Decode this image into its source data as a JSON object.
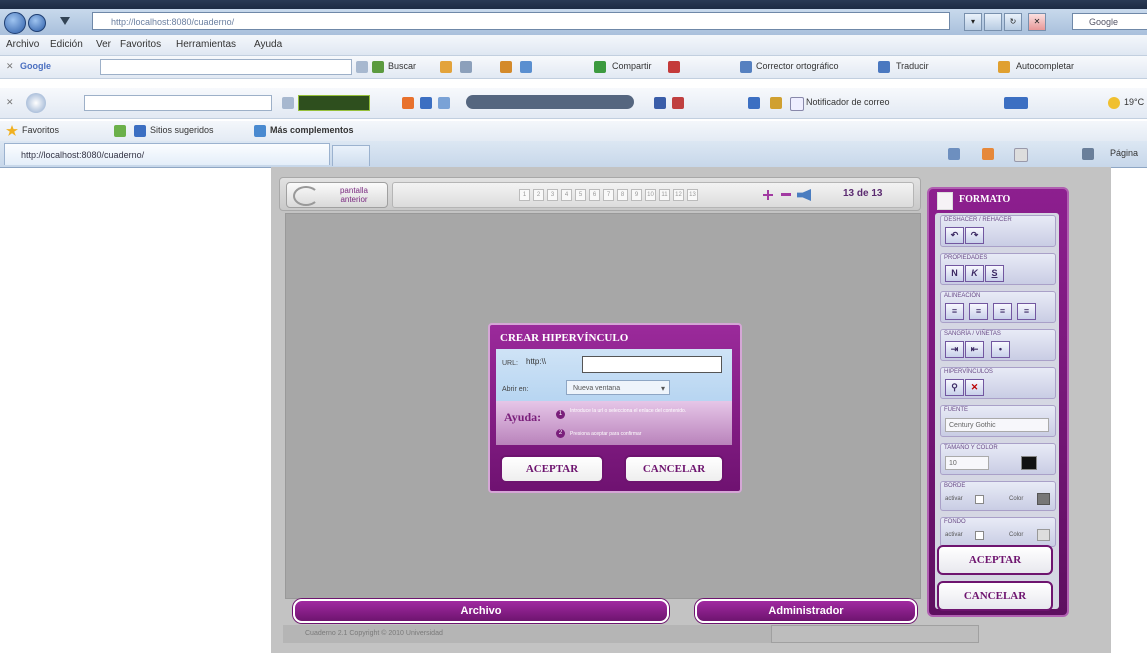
{
  "browser": {
    "url": "http://localhost:8080/cuaderno/",
    "search_label": "Google",
    "tab_label": "http://localhost:8080/cuaderno/",
    "tab_tools_label": "Página",
    "menu": [
      "Archivo",
      "Edición",
      "Ver",
      "Favoritos",
      "Herramientas",
      "Ayuda"
    ],
    "google_toolbar": {
      "logo": "Google",
      "buscar": "Buscar",
      "compartir": "Compartir",
      "corrector": "Corrector ortográfico",
      "traducir": "Traducir",
      "autocompletar": "Autocompletar"
    },
    "toolbar2": {
      "notifier": "Notificador de correo",
      "temp": "19°C"
    },
    "favorites": {
      "favoritos": "Favoritos",
      "sitios": "Sitios sugeridos",
      "mas": "Más complementos"
    }
  },
  "app": {
    "prev_page_label": "pantalla anterior",
    "page_counter": "13 de 13",
    "pages": [
      "1",
      "2",
      "3",
      "4",
      "5",
      "6",
      "7",
      "8",
      "9",
      "10",
      "11",
      "12",
      "13"
    ],
    "archivo_button": "Archivo",
    "admin_button": "Administrador",
    "status_text": "Cuaderno 2.1 Copyright © 2010 Universidad"
  },
  "formato": {
    "title": "FORMATO",
    "sections": {
      "deshacer": "DESHACER / REHACER",
      "propiedades": "PROPIEDADES",
      "alineacion": "ALINEACIÓN",
      "sangria": "SANGRÍA / VIÑETAS",
      "hipervinculos": "HIPERVÍNCULOS",
      "fuente": "FUENTE",
      "tamano": "TAMAÑO Y COLOR",
      "borde": "BORDE",
      "fondo": "FONDO"
    },
    "bold": "N",
    "italic": "K",
    "underline": "S",
    "font_value": "Century Gothic",
    "size_value": "10",
    "borde_check": "activar",
    "borde_color_label": "Color",
    "fondo_check": "activar",
    "fondo_color_label": "Color",
    "aceptar": "ACEPTAR",
    "cancelar": "CANCELAR"
  },
  "dialog": {
    "title": "CREAR HIPERVÍNCULO",
    "url_label": "URL:",
    "url_value": "http:\\\\",
    "open_label": "Abrir en:",
    "open_value": "Nueva ventana",
    "help_label": "Ayuda:",
    "help_1": "Introduce la url o selecciona el enlace del contenido.",
    "help_2": "Presiona aceptar para confirmar",
    "aceptar": "ACEPTAR",
    "cancelar": "CANCELAR"
  }
}
